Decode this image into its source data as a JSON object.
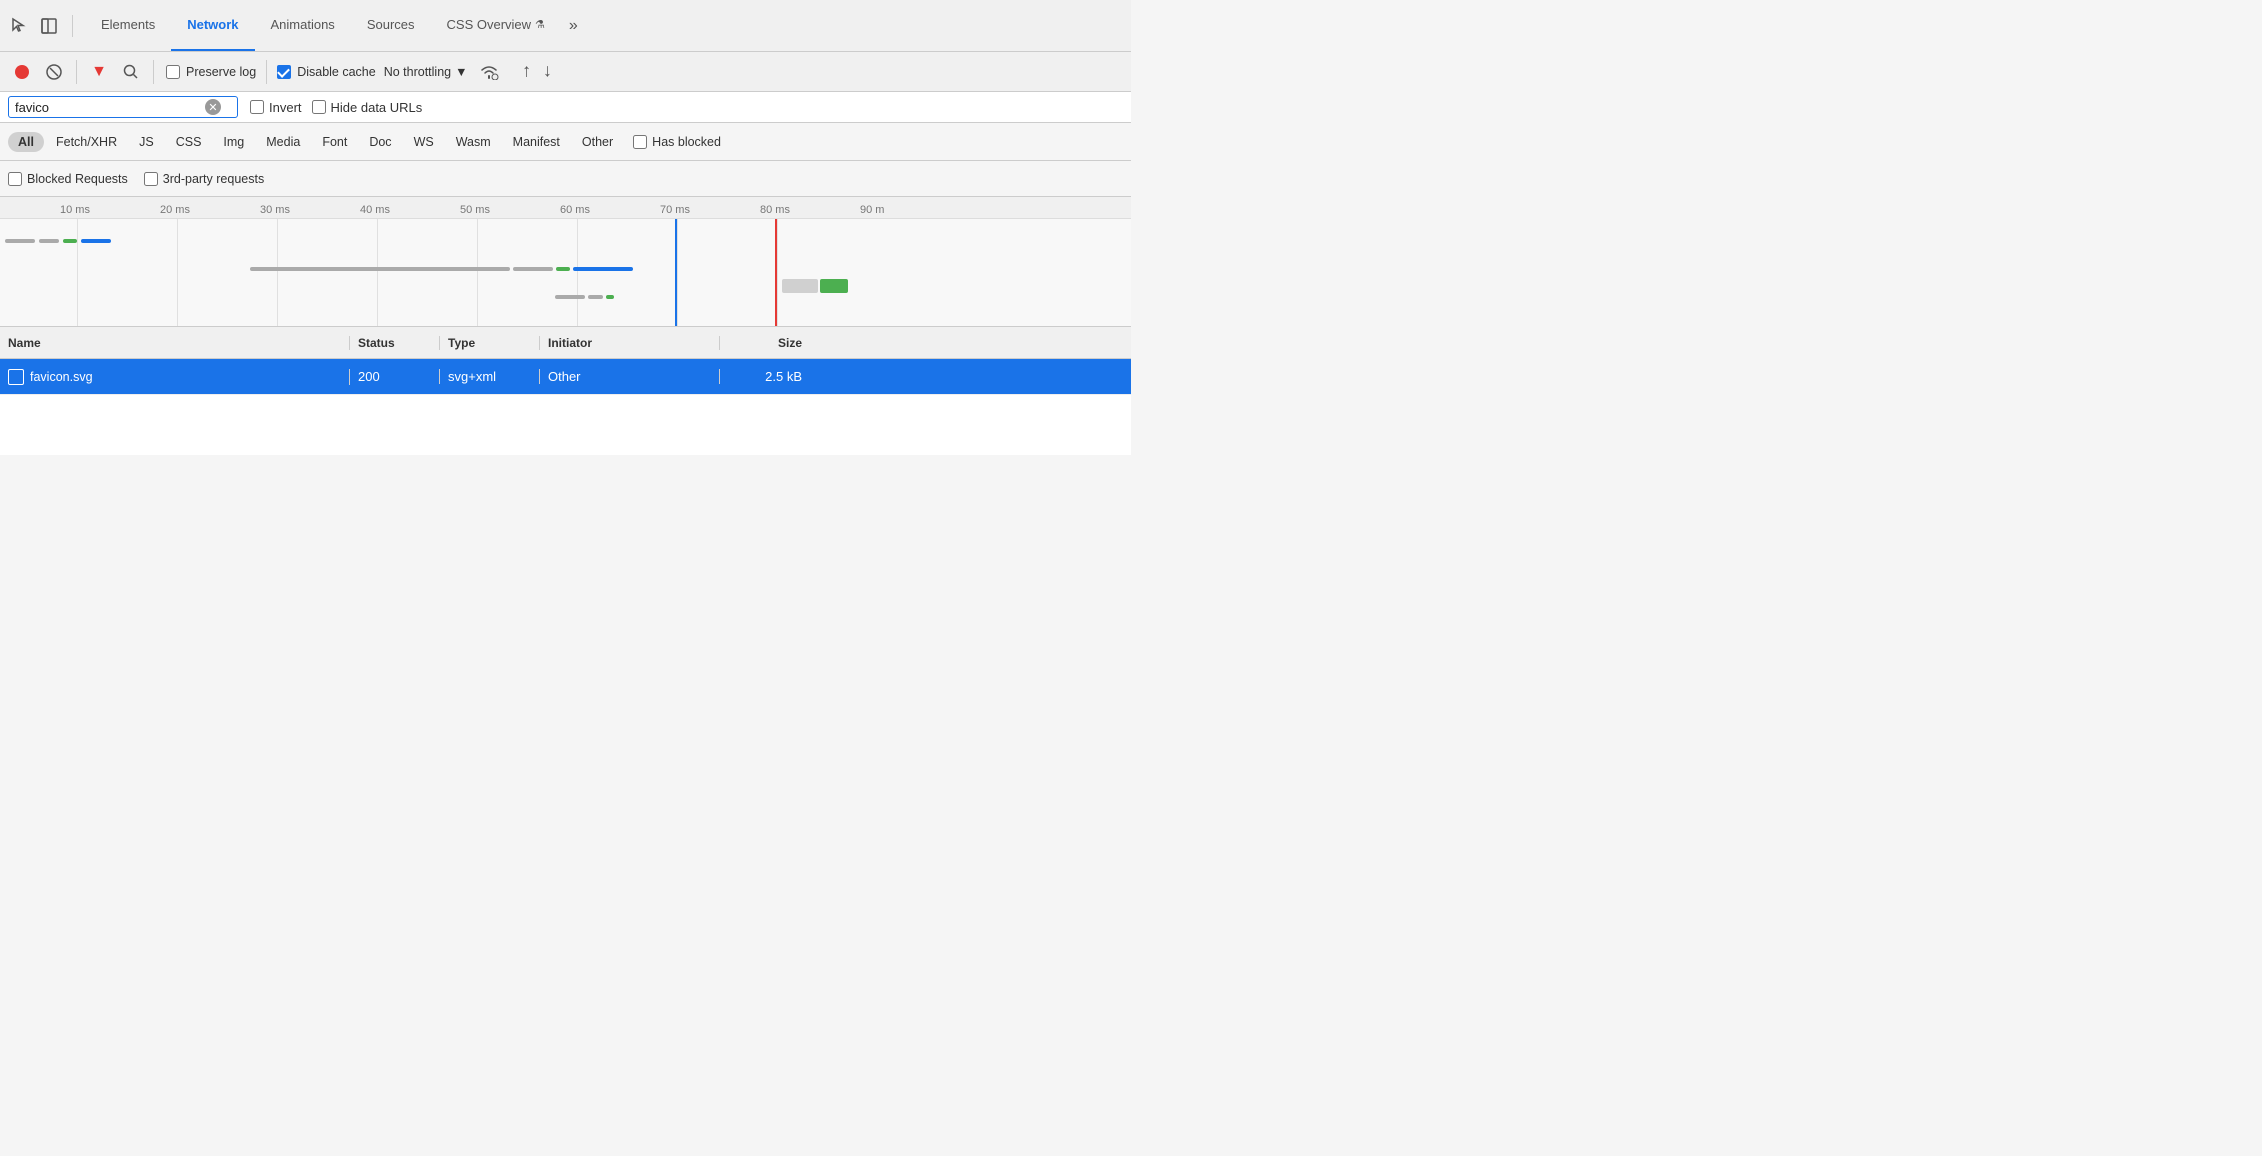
{
  "tabs": {
    "items": [
      {
        "label": "Elements",
        "active": false
      },
      {
        "label": "Network",
        "active": true
      },
      {
        "label": "Animations",
        "active": false
      },
      {
        "label": "Sources",
        "active": false
      },
      {
        "label": "CSS Overview",
        "active": false
      }
    ],
    "more_label": "»"
  },
  "toolbar": {
    "preserve_log_label": "Preserve log",
    "disable_cache_label": "Disable cache",
    "no_throttling_label": "No throttling"
  },
  "filter": {
    "search_value": "favico",
    "search_placeholder": "Filter",
    "invert_label": "Invert",
    "hide_data_urls_label": "Hide data URLs"
  },
  "type_filters": {
    "items": [
      "All",
      "Fetch/XHR",
      "JS",
      "CSS",
      "Img",
      "Media",
      "Font",
      "Doc",
      "WS",
      "Wasm",
      "Manifest",
      "Other"
    ],
    "active": "All",
    "has_blocked_label": "Has blocked"
  },
  "blocked_bar": {
    "blocked_requests_label": "Blocked Requests",
    "third_party_label": "3rd-party requests"
  },
  "timeline": {
    "ticks": [
      "10 ms",
      "20 ms",
      "30 ms",
      "40 ms",
      "50 ms",
      "60 ms",
      "70 ms",
      "80 ms",
      "90 m"
    ]
  },
  "table": {
    "headers": {
      "name": "Name",
      "status": "Status",
      "type": "Type",
      "initiator": "Initiator",
      "size": "Size"
    },
    "rows": [
      {
        "name": "favicon.svg",
        "status": "200",
        "type": "svg+xml",
        "initiator": "Other",
        "size": "2.5 kB",
        "selected": true
      }
    ]
  }
}
